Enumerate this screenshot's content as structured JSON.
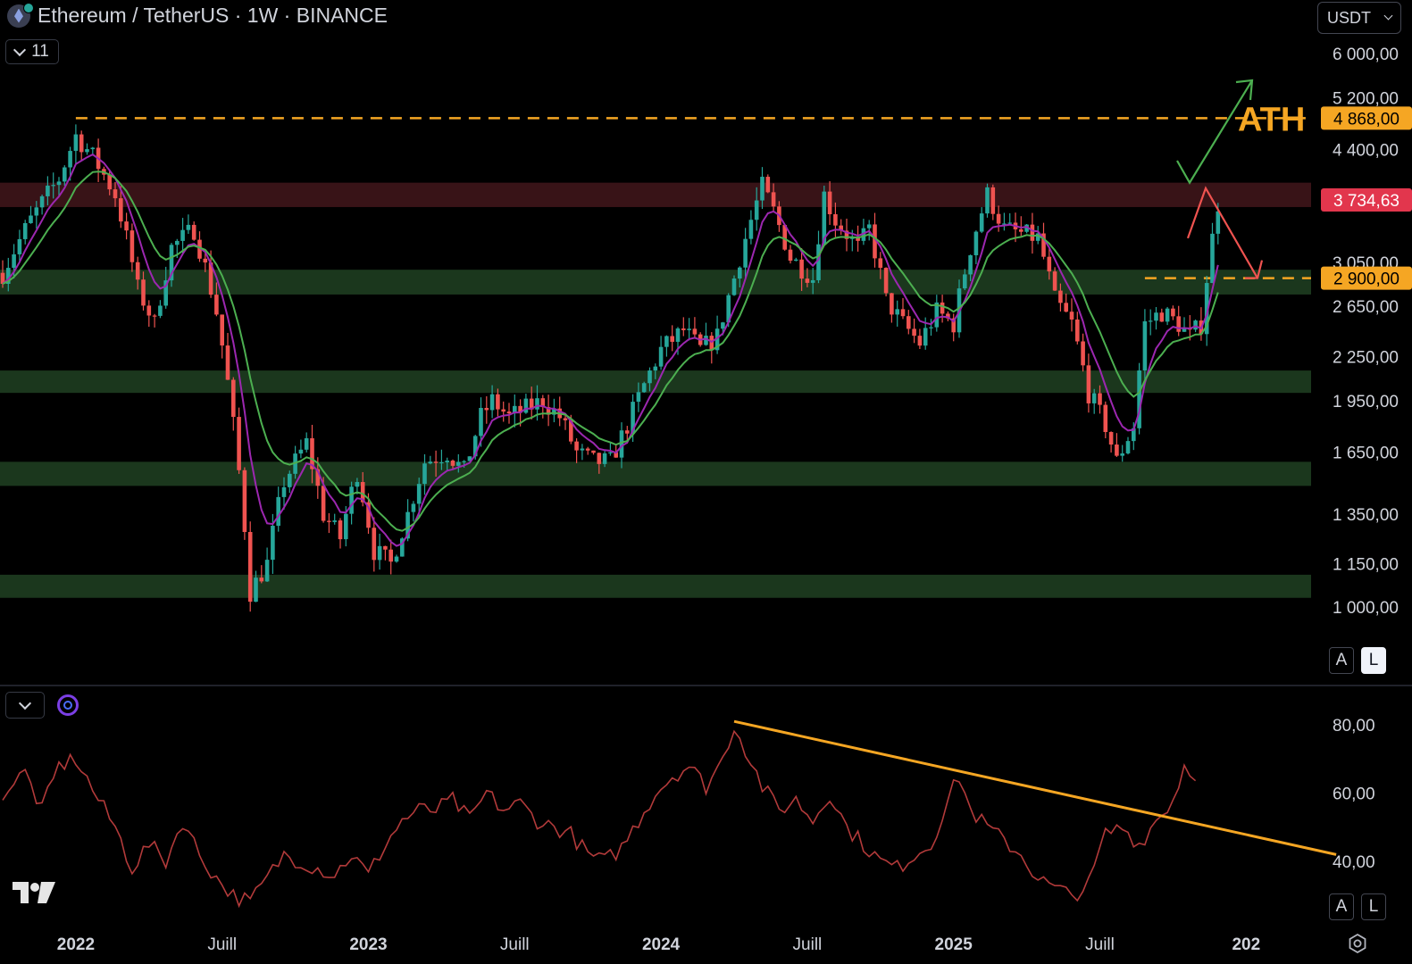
{
  "header": {
    "title": "Ethereum / TetherUS · 1W · BINANCE",
    "indicator_count": "11",
    "currency": "USDT"
  },
  "scale_buttons": {
    "auto": "A",
    "log": "L"
  },
  "colors": {
    "up": "#26a69a",
    "down": "#ef5350",
    "ema_fast": "#9c27b0",
    "ema_slow": "#4caf50",
    "ath": "#f5a623",
    "current": "#e2364d",
    "support": "#1c3a1f",
    "resistance": "#3b1418"
  },
  "chart_data": [
    {
      "type": "candlestick",
      "title": "Ethereum / TetherUS · 1W · BINANCE",
      "y_scale": "log",
      "ylim": [
        820,
        6200
      ],
      "y_ticks": [
        "6 000,00",
        "5 200,00",
        "4 400,00",
        "3 050,00",
        "2 650,00",
        "2 250,00",
        "1 950,00",
        "1 650,00",
        "1 350,00",
        "1 150,00",
        "1 000,00"
      ],
      "y_tick_values": [
        6000,
        5200,
        4400,
        3050,
        2650,
        2250,
        1950,
        1650,
        1350,
        1150,
        1000
      ],
      "x_ticks": [
        "2022",
        "Juill",
        "2023",
        "Juill",
        "2024",
        "Juill",
        "2025",
        "Juill",
        "202"
      ],
      "x_tick_weeks": [
        13,
        39,
        65,
        91,
        117,
        143,
        169,
        195,
        221
      ],
      "anchors": [
        {
          "week": 0,
          "price": 2950
        },
        {
          "week": 5,
          "price": 3500
        },
        {
          "week": 10,
          "price": 4000
        },
        {
          "week": 13,
          "price": 4600
        },
        {
          "week": 16,
          "price": 4300
        },
        {
          "week": 20,
          "price": 3800
        },
        {
          "week": 24,
          "price": 2800
        },
        {
          "week": 27,
          "price": 2500
        },
        {
          "week": 30,
          "price": 3200
        },
        {
          "week": 34,
          "price": 3400
        },
        {
          "week": 38,
          "price": 2600
        },
        {
          "week": 41,
          "price": 1800
        },
        {
          "week": 44,
          "price": 1050
        },
        {
          "week": 47,
          "price": 1150
        },
        {
          "week": 50,
          "price": 1500
        },
        {
          "week": 54,
          "price": 1700
        },
        {
          "week": 57,
          "price": 1350
        },
        {
          "week": 60,
          "price": 1250
        },
        {
          "week": 63,
          "price": 1550
        },
        {
          "week": 66,
          "price": 1200
        },
        {
          "week": 69,
          "price": 1150
        },
        {
          "week": 72,
          "price": 1350
        },
        {
          "week": 75,
          "price": 1600
        },
        {
          "week": 79,
          "price": 1650
        },
        {
          "week": 82,
          "price": 1550
        },
        {
          "week": 85,
          "price": 1850
        },
        {
          "week": 87,
          "price": 1950
        },
        {
          "week": 90,
          "price": 1850
        },
        {
          "week": 93,
          "price": 1900
        },
        {
          "week": 96,
          "price": 1950
        },
        {
          "week": 99,
          "price": 1850
        },
        {
          "week": 102,
          "price": 1650
        },
        {
          "week": 105,
          "price": 1600
        },
        {
          "week": 108,
          "price": 1600
        },
        {
          "week": 111,
          "price": 1800
        },
        {
          "week": 114,
          "price": 2050
        },
        {
          "week": 117,
          "price": 2300
        },
        {
          "week": 121,
          "price": 2450
        },
        {
          "week": 124,
          "price": 2300
        },
        {
          "week": 127,
          "price": 2400
        },
        {
          "week": 130,
          "price": 2900
        },
        {
          "week": 133,
          "price": 3500
        },
        {
          "week": 135,
          "price": 3900
        },
        {
          "week": 137,
          "price": 3600
        },
        {
          "week": 140,
          "price": 3100
        },
        {
          "week": 142,
          "price": 3000
        },
        {
          "week": 144,
          "price": 2900
        },
        {
          "week": 146,
          "price": 3800
        },
        {
          "week": 148,
          "price": 3500
        },
        {
          "week": 150,
          "price": 3350
        },
        {
          "week": 152,
          "price": 3200
        },
        {
          "week": 154,
          "price": 3400
        },
        {
          "week": 157,
          "price": 2700
        },
        {
          "week": 160,
          "price": 2500
        },
        {
          "week": 163,
          "price": 2350
        },
        {
          "week": 166,
          "price": 2600
        },
        {
          "week": 169,
          "price": 2500
        },
        {
          "week": 172,
          "price": 3200
        },
        {
          "week": 175,
          "price": 3800
        },
        {
          "week": 178,
          "price": 3400
        },
        {
          "week": 181,
          "price": 3350
        },
        {
          "week": 184,
          "price": 3300
        },
        {
          "week": 187,
          "price": 2700
        },
        {
          "week": 190,
          "price": 2500
        },
        {
          "week": 193,
          "price": 2000
        },
        {
          "week": 196,
          "price": 1800
        },
        {
          "week": 198,
          "price": 1600
        },
        {
          "week": 201,
          "price": 1800
        },
        {
          "week": 203,
          "price": 2500
        },
        {
          "week": 206,
          "price": 2600
        },
        {
          "week": 209,
          "price": 2500
        },
        {
          "week": 211,
          "price": 2400
        },
        {
          "week": 213,
          "price": 2500
        },
        {
          "week": 214,
          "price": 2900
        },
        {
          "week": 216,
          "price": 3700
        }
      ],
      "price_levels": [
        {
          "name": "ATH",
          "value": 4868,
          "label": "4 868,00",
          "style": "dashed"
        },
        {
          "name": "current",
          "value": 3734.63,
          "label": "3 734,63",
          "style": "none"
        },
        {
          "name": "support",
          "value": 2900,
          "label": "2 900,00",
          "style": "dashed"
        }
      ],
      "zones": [
        {
          "kind": "resistance",
          "low": 3650,
          "high": 3950
        },
        {
          "kind": "support",
          "low": 2750,
          "high": 2980
        },
        {
          "kind": "support",
          "low": 2000,
          "high": 2150
        },
        {
          "kind": "support",
          "low": 1480,
          "high": 1600
        },
        {
          "kind": "support",
          "low": 1030,
          "high": 1110
        }
      ],
      "annotations": [
        {
          "text": "ATH",
          "type": "label"
        },
        {
          "type": "arrow",
          "direction": "up",
          "color": "#4caf50"
        },
        {
          "type": "arrow",
          "direction": "down",
          "color": "#ef5350"
        }
      ]
    },
    {
      "type": "line",
      "ylim": [
        25,
        85
      ],
      "y_ticks": [
        "80,00",
        "60,00",
        "40,00"
      ],
      "y_tick_values": [
        80,
        60,
        40
      ],
      "anchors": [
        {
          "week": 0,
          "value": 60
        },
        {
          "week": 4,
          "value": 66
        },
        {
          "week": 7,
          "value": 55
        },
        {
          "week": 10,
          "value": 68
        },
        {
          "week": 13,
          "value": 70
        },
        {
          "week": 17,
          "value": 58
        },
        {
          "week": 20,
          "value": 50
        },
        {
          "week": 23,
          "value": 38
        },
        {
          "week": 26,
          "value": 45
        },
        {
          "week": 29,
          "value": 40
        },
        {
          "week": 32,
          "value": 52
        },
        {
          "week": 35,
          "value": 42
        },
        {
          "week": 38,
          "value": 35
        },
        {
          "week": 41,
          "value": 30
        },
        {
          "week": 44,
          "value": 28
        },
        {
          "week": 47,
          "value": 35
        },
        {
          "week": 50,
          "value": 42
        },
        {
          "week": 53,
          "value": 40
        },
        {
          "week": 56,
          "value": 38
        },
        {
          "week": 59,
          "value": 36
        },
        {
          "week": 62,
          "value": 42
        },
        {
          "week": 65,
          "value": 36
        },
        {
          "week": 68,
          "value": 45
        },
        {
          "week": 71,
          "value": 52
        },
        {
          "week": 74,
          "value": 55
        },
        {
          "week": 77,
          "value": 55
        },
        {
          "week": 80,
          "value": 58
        },
        {
          "week": 83,
          "value": 52
        },
        {
          "week": 86,
          "value": 60
        },
        {
          "week": 89,
          "value": 55
        },
        {
          "week": 92,
          "value": 57
        },
        {
          "week": 95,
          "value": 52
        },
        {
          "week": 98,
          "value": 50
        },
        {
          "week": 101,
          "value": 48
        },
        {
          "week": 104,
          "value": 42
        },
        {
          "week": 107,
          "value": 40
        },
        {
          "week": 110,
          "value": 44
        },
        {
          "week": 113,
          "value": 52
        },
        {
          "week": 116,
          "value": 60
        },
        {
          "week": 119,
          "value": 65
        },
        {
          "week": 122,
          "value": 68
        },
        {
          "week": 125,
          "value": 62
        },
        {
          "week": 128,
          "value": 70
        },
        {
          "week": 130,
          "value": 80
        },
        {
          "week": 132,
          "value": 73
        },
        {
          "week": 135,
          "value": 62
        },
        {
          "week": 138,
          "value": 55
        },
        {
          "week": 141,
          "value": 58
        },
        {
          "week": 144,
          "value": 52
        },
        {
          "week": 147,
          "value": 60
        },
        {
          "week": 150,
          "value": 50
        },
        {
          "week": 153,
          "value": 45
        },
        {
          "week": 156,
          "value": 40
        },
        {
          "week": 159,
          "value": 38
        },
        {
          "week": 162,
          "value": 42
        },
        {
          "week": 165,
          "value": 45
        },
        {
          "week": 168,
          "value": 58
        },
        {
          "week": 170,
          "value": 65
        },
        {
          "week": 172,
          "value": 55
        },
        {
          "week": 175,
          "value": 50
        },
        {
          "week": 178,
          "value": 46
        },
        {
          "week": 181,
          "value": 42
        },
        {
          "week": 184,
          "value": 35
        },
        {
          "week": 187,
          "value": 32
        },
        {
          "week": 190,
          "value": 30
        },
        {
          "week": 193,
          "value": 33
        },
        {
          "week": 196,
          "value": 48
        },
        {
          "week": 199,
          "value": 50
        },
        {
          "week": 202,
          "value": 45
        },
        {
          "week": 205,
          "value": 52
        },
        {
          "week": 208,
          "value": 58
        },
        {
          "week": 210,
          "value": 68
        },
        {
          "week": 212,
          "value": 66
        }
      ],
      "trendline": {
        "from": {
          "week": 130,
          "value": 81
        },
        "to": {
          "week": 237,
          "value": 42
        }
      }
    }
  ]
}
